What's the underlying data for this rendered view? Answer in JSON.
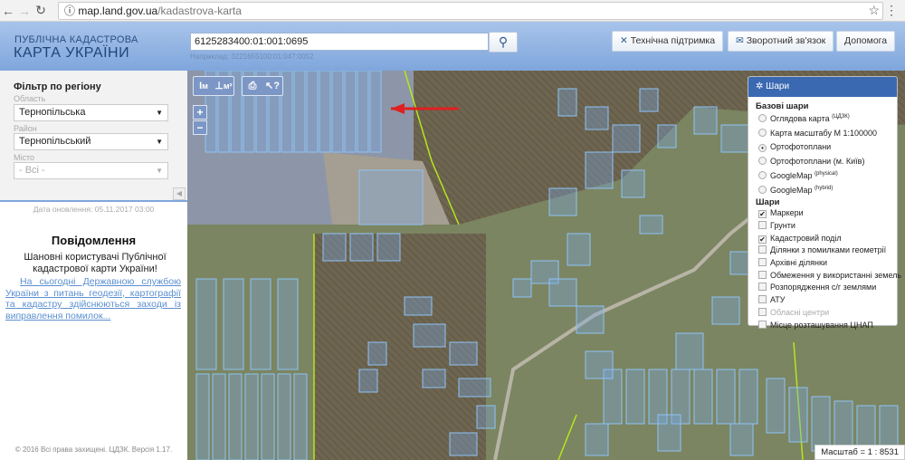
{
  "browser": {
    "url_host": "map.land.gov.ua",
    "url_path": "/kadastrova-karta"
  },
  "header": {
    "logo_line1": "ПУБЛІЧНА КАДАСТРОВА",
    "logo_line2": "КАРТА УКРАЇНИ",
    "search_value": "6125283400:01:001:0695",
    "search_example": "Наприклад: 3221655100:01:047:0052",
    "support": "Технічна підтримка",
    "feedback": "Зворотний зв'язок",
    "help": "Допомога"
  },
  "filter": {
    "title": "Фільтр по регіону",
    "oblast_label": "Область",
    "oblast_value": "Тернопільська",
    "raion_label": "Район",
    "raion_value": "Тернопільський",
    "city_label": "Місто",
    "city_value": "- Всі -"
  },
  "sidebar": {
    "date": "Дата оновлення: 05.11.2017 03:00",
    "notice_title": "Повідомлення",
    "notice_greeting": "Шановні користувачі Публічної кадастрової карти України!",
    "notice_link": "На сьогодні Державною службою України з питань геодезії, картографії та кадастру здійснюються заходи із виправлення помилок...",
    "copyright": "© 2016 Всі права захищені. ЦДЗК. Версія 1.17."
  },
  "map": {
    "scale": "Масштаб = 1 : 8531",
    "tools": [
      "I м",
      "⊥ м²",
      "print",
      "?"
    ],
    "accent": "#3a69b2"
  },
  "layers": {
    "title": "Шари",
    "base_title": "Базові шари",
    "base": [
      {
        "label": "Оглядова карта",
        "sup": "(ЦДЗК)",
        "checked": false
      },
      {
        "label": "Карта масштабу М 1:100000",
        "sup": "",
        "checked": false
      },
      {
        "label": "Ортофотоплани",
        "sup": "",
        "checked": true
      },
      {
        "label": "Ортофотоплани (м. Київ)",
        "sup": "",
        "checked": false
      },
      {
        "label": "GoogleMap",
        "sup": "(physical)",
        "checked": false
      },
      {
        "label": "GoogleMap",
        "sup": "(hybrid)",
        "checked": false
      }
    ],
    "layers_title": "Шари",
    "items": [
      {
        "label": "Маркери",
        "checked": true
      },
      {
        "label": "Грунти",
        "checked": false
      },
      {
        "label": "Кадастровий поділ",
        "checked": true
      },
      {
        "label": "Ділянки з помилками геометрії",
        "checked": false
      },
      {
        "label": "Архівні ділянки",
        "checked": false
      },
      {
        "label": "Обмеження у використанні земель",
        "checked": false
      },
      {
        "label": "Розпорядження с/г землями",
        "checked": false
      },
      {
        "label": "АТУ",
        "checked": false
      },
      {
        "label": "Обласні центри",
        "checked": false,
        "disabled": true
      },
      {
        "label": "Місце розташування ЦНАП",
        "checked": false
      }
    ]
  }
}
